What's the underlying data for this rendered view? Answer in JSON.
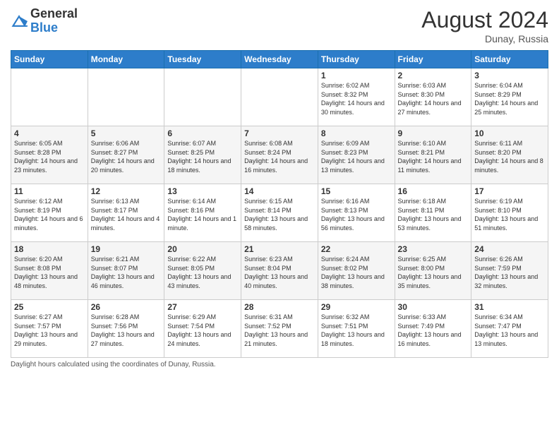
{
  "header": {
    "logo_general": "General",
    "logo_blue": "Blue",
    "month_year": "August 2024",
    "location": "Dunay, Russia"
  },
  "weekdays": [
    "Sunday",
    "Monday",
    "Tuesday",
    "Wednesday",
    "Thursday",
    "Friday",
    "Saturday"
  ],
  "weeks": [
    [
      {
        "day": "",
        "info": ""
      },
      {
        "day": "",
        "info": ""
      },
      {
        "day": "",
        "info": ""
      },
      {
        "day": "",
        "info": ""
      },
      {
        "day": "1",
        "info": "Sunrise: 6:02 AM\nSunset: 8:32 PM\nDaylight: 14 hours and 30 minutes."
      },
      {
        "day": "2",
        "info": "Sunrise: 6:03 AM\nSunset: 8:30 PM\nDaylight: 14 hours and 27 minutes."
      },
      {
        "day": "3",
        "info": "Sunrise: 6:04 AM\nSunset: 8:29 PM\nDaylight: 14 hours and 25 minutes."
      }
    ],
    [
      {
        "day": "4",
        "info": "Sunrise: 6:05 AM\nSunset: 8:28 PM\nDaylight: 14 hours and 23 minutes."
      },
      {
        "day": "5",
        "info": "Sunrise: 6:06 AM\nSunset: 8:27 PM\nDaylight: 14 hours and 20 minutes."
      },
      {
        "day": "6",
        "info": "Sunrise: 6:07 AM\nSunset: 8:25 PM\nDaylight: 14 hours and 18 minutes."
      },
      {
        "day": "7",
        "info": "Sunrise: 6:08 AM\nSunset: 8:24 PM\nDaylight: 14 hours and 16 minutes."
      },
      {
        "day": "8",
        "info": "Sunrise: 6:09 AM\nSunset: 8:23 PM\nDaylight: 14 hours and 13 minutes."
      },
      {
        "day": "9",
        "info": "Sunrise: 6:10 AM\nSunset: 8:21 PM\nDaylight: 14 hours and 11 minutes."
      },
      {
        "day": "10",
        "info": "Sunrise: 6:11 AM\nSunset: 8:20 PM\nDaylight: 14 hours and 8 minutes."
      }
    ],
    [
      {
        "day": "11",
        "info": "Sunrise: 6:12 AM\nSunset: 8:19 PM\nDaylight: 14 hours and 6 minutes."
      },
      {
        "day": "12",
        "info": "Sunrise: 6:13 AM\nSunset: 8:17 PM\nDaylight: 14 hours and 4 minutes."
      },
      {
        "day": "13",
        "info": "Sunrise: 6:14 AM\nSunset: 8:16 PM\nDaylight: 14 hours and 1 minute."
      },
      {
        "day": "14",
        "info": "Sunrise: 6:15 AM\nSunset: 8:14 PM\nDaylight: 13 hours and 58 minutes."
      },
      {
        "day": "15",
        "info": "Sunrise: 6:16 AM\nSunset: 8:13 PM\nDaylight: 13 hours and 56 minutes."
      },
      {
        "day": "16",
        "info": "Sunrise: 6:18 AM\nSunset: 8:11 PM\nDaylight: 13 hours and 53 minutes."
      },
      {
        "day": "17",
        "info": "Sunrise: 6:19 AM\nSunset: 8:10 PM\nDaylight: 13 hours and 51 minutes."
      }
    ],
    [
      {
        "day": "18",
        "info": "Sunrise: 6:20 AM\nSunset: 8:08 PM\nDaylight: 13 hours and 48 minutes."
      },
      {
        "day": "19",
        "info": "Sunrise: 6:21 AM\nSunset: 8:07 PM\nDaylight: 13 hours and 46 minutes."
      },
      {
        "day": "20",
        "info": "Sunrise: 6:22 AM\nSunset: 8:05 PM\nDaylight: 13 hours and 43 minutes."
      },
      {
        "day": "21",
        "info": "Sunrise: 6:23 AM\nSunset: 8:04 PM\nDaylight: 13 hours and 40 minutes."
      },
      {
        "day": "22",
        "info": "Sunrise: 6:24 AM\nSunset: 8:02 PM\nDaylight: 13 hours and 38 minutes."
      },
      {
        "day": "23",
        "info": "Sunrise: 6:25 AM\nSunset: 8:00 PM\nDaylight: 13 hours and 35 minutes."
      },
      {
        "day": "24",
        "info": "Sunrise: 6:26 AM\nSunset: 7:59 PM\nDaylight: 13 hours and 32 minutes."
      }
    ],
    [
      {
        "day": "25",
        "info": "Sunrise: 6:27 AM\nSunset: 7:57 PM\nDaylight: 13 hours and 29 minutes."
      },
      {
        "day": "26",
        "info": "Sunrise: 6:28 AM\nSunset: 7:56 PM\nDaylight: 13 hours and 27 minutes."
      },
      {
        "day": "27",
        "info": "Sunrise: 6:29 AM\nSunset: 7:54 PM\nDaylight: 13 hours and 24 minutes."
      },
      {
        "day": "28",
        "info": "Sunrise: 6:31 AM\nSunset: 7:52 PM\nDaylight: 13 hours and 21 minutes."
      },
      {
        "day": "29",
        "info": "Sunrise: 6:32 AM\nSunset: 7:51 PM\nDaylight: 13 hours and 18 minutes."
      },
      {
        "day": "30",
        "info": "Sunrise: 6:33 AM\nSunset: 7:49 PM\nDaylight: 13 hours and 16 minutes."
      },
      {
        "day": "31",
        "info": "Sunrise: 6:34 AM\nSunset: 7:47 PM\nDaylight: 13 hours and 13 minutes."
      }
    ]
  ],
  "footer": {
    "daylight_label": "Daylight hours"
  }
}
